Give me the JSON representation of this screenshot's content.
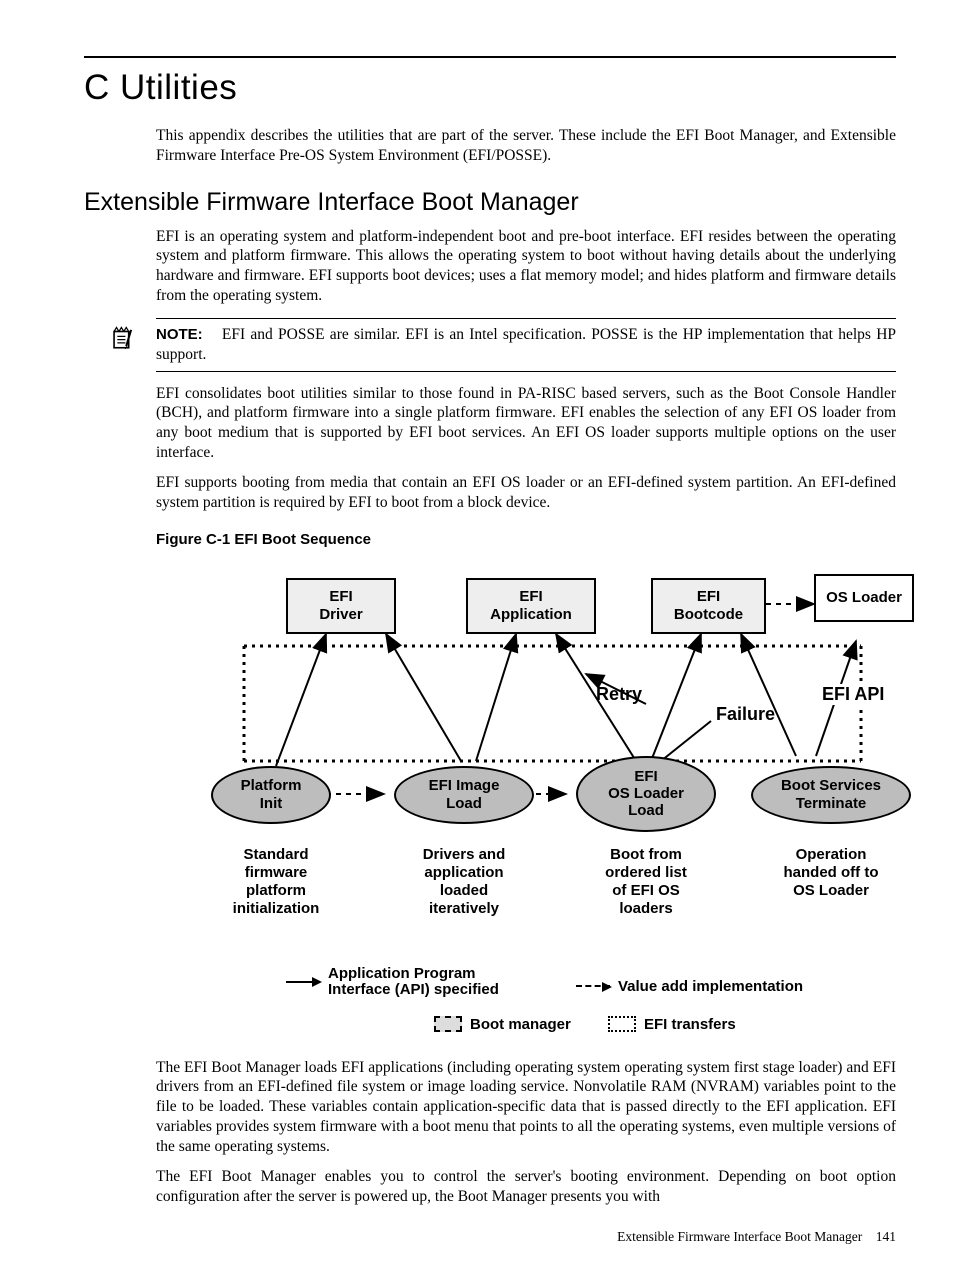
{
  "title": "C Utilities",
  "intro": "This appendix describes the utilities that are part of the server. These include the EFI Boot Manager, and Extensible Firmware Interface Pre-OS System Environment (EFI/POSSE).",
  "section_h2": "Extensible Firmware Interface Boot Manager",
  "para1": "EFI is an operating system and platform-independent boot and pre-boot interface. EFI resides between the operating system and platform firmware. This allows the operating system to boot without having details about the underlying hardware and firmware. EFI supports boot devices; uses a flat memory model; and hides platform and firmware details from the operating system.",
  "note": {
    "label": "NOTE:",
    "text": "EFI and POSSE are similar. EFI is an Intel specification. POSSE is the HP implementation that helps HP support."
  },
  "para2": "EFI consolidates boot utilities similar to those found in PA-RISC based servers, such as the Boot Console Handler (BCH), and platform firmware into a single platform firmware. EFI enables the selection of any EFI OS loader from any boot medium that is supported by EFI boot services. An EFI OS loader supports multiple options on the user interface.",
  "para3": "EFI supports booting from media that contain an EFI OS loader or an EFI-defined system partition. An EFI-defined system partition is required by EFI to boot from a block device.",
  "figure_caption": "Figure C-1 EFI Boot Sequence",
  "diagram": {
    "boxes": {
      "driver": "EFI\nDriver",
      "app": "EFI\nApplication",
      "bootcode": "EFI\nBootcode",
      "osloader": "OS Loader"
    },
    "api_label": "EFI API",
    "retry": "Retry",
    "failure": "Failure",
    "ellipses": {
      "platform": "Platform\nInit",
      "image": "EFI Image\nLoad",
      "osload": "EFI\nOS Loader\nLoad",
      "bst": "Boot Services\nTerminate"
    },
    "captions": {
      "c1": "Standard\nfirmware\nplatform\ninitialization",
      "c2": "Drivers and\napplication\nloaded\niteratively",
      "c3": "Boot from\nordered list\nof EFI OS\nloaders",
      "c4": "Operation\nhanded off to\nOS Loader"
    },
    "legend": {
      "api": "Application Program\nInterface (API) specified",
      "value": "Value add implementation",
      "bootmgr": "Boot manager",
      "efitrans": "EFI transfers"
    }
  },
  "para4": "The EFI Boot Manager loads EFI applications (including operating system operating system first stage loader) and EFI drivers from an EFI-defined file system or image loading service. Nonvolatile RAM (NVRAM) variables point to the file to be loaded. These variables contain application-specific data that is passed directly to the EFI application. EFI variables provides system firmware with a boot menu that points to all the operating systems, even multiple versions of the same operating systems.",
  "para5": "The EFI Boot Manager enables you to control the server's booting environment. Depending on boot option configuration after the server is powered up, the Boot Manager presents you with",
  "footer": {
    "section": "Extensible Firmware Interface Boot Manager",
    "page": "141"
  }
}
